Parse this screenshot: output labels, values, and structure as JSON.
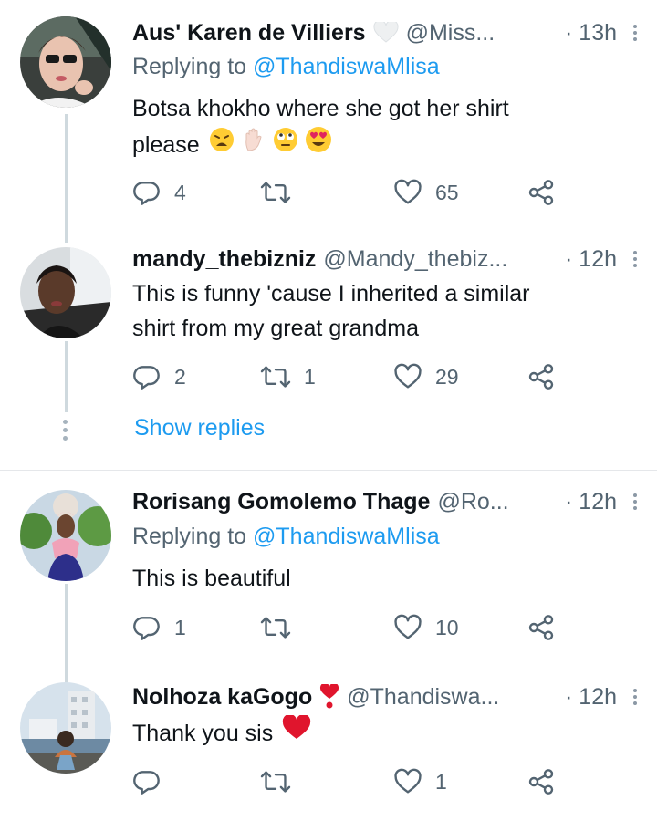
{
  "colors": {
    "accent": "#1d9bf0",
    "secondary_text": "#536471",
    "primary_text": "#0f1419",
    "thread_line": "#cfd9de"
  },
  "tweets": [
    {
      "name": "Aus' Karen de Villiers",
      "name_emoji": "white-heart",
      "handle": "@Miss...",
      "time": "· 13h",
      "replying_prefix": "Replying to ",
      "replying_to": "@ThandiswaMlisa",
      "text_line1": "Botsa khokho where she got her shirt",
      "text_line2": "please",
      "text_emojis": [
        "weary-face",
        "raised-hand-light",
        "face-with-rolling-eyes",
        "heart-eyes"
      ],
      "replies": "4",
      "retweets": "",
      "likes": "65"
    },
    {
      "name": "mandy_thebizniz",
      "handle": "@Mandy_thebiz...",
      "time": "· 12h",
      "text_line1": "This is funny 'cause I inherited a similar",
      "text_line2": "shirt from my great grandma",
      "replies": "2",
      "retweets": "1",
      "likes": "29",
      "show_replies": "Show replies"
    },
    {
      "name": "Rorisang Gomolemo Thage",
      "handle": "@Ro...",
      "time": "· 12h",
      "replying_prefix": "Replying to ",
      "replying_to": "@ThandiswaMlisa",
      "text_line1": "This is beautiful",
      "replies": "1",
      "retweets": "",
      "likes": "10"
    },
    {
      "name": "Nolhoza kaGogo",
      "name_emoji": "heavy-exclamation-heart",
      "handle": "@Thandiswa...",
      "time": "· 12h",
      "text_line1": "Thank you sis",
      "text_emojis": [
        "red-heart"
      ],
      "replies": "",
      "retweets": "",
      "likes": "1"
    }
  ]
}
